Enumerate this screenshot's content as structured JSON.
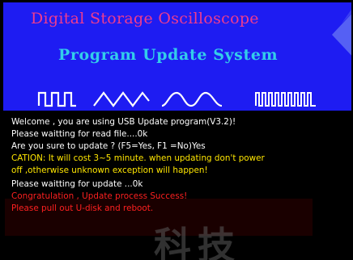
{
  "banner": {
    "title": "Digital Storage Oscilloscope",
    "subtitle": "Program Update System"
  },
  "console": {
    "lines": [
      {
        "text": "Welcome , you are using USB Update program(V3.2)!",
        "color": "#ffffff"
      },
      {
        "text": "Please waitting for read file....0k",
        "color": "#ffffff"
      },
      {
        "text": "Are you sure to update ? (F5=Yes, F1 =No)Yes",
        "color": "#ffffff"
      },
      {
        "text": "CATION: It will cost 3~5 minute. when updating don't power",
        "color": "#ffe600"
      },
      {
        "text": "off ,otherwise unknown exception will happen!",
        "color": "#ffe600"
      },
      {
        "text": "Please waitting for update ...0k",
        "color": "#ffffff"
      },
      {
        "text": "Congratulation , Update process Success!",
        "color": "#ff2020"
      },
      {
        "text": "Please pull out U-disk and reboot.",
        "color": "#ff2020"
      }
    ]
  },
  "watermark": {
    "text": "科技"
  },
  "colors": {
    "banner_bg": "#1e1cf2",
    "title": "#ee3c8e",
    "subtitle": "#33cdea",
    "console_bg": "#000000"
  },
  "icons": [
    "square-wave-icon",
    "triangle-wave-icon",
    "sine-wave-icon",
    "pulse-train-icon"
  ]
}
